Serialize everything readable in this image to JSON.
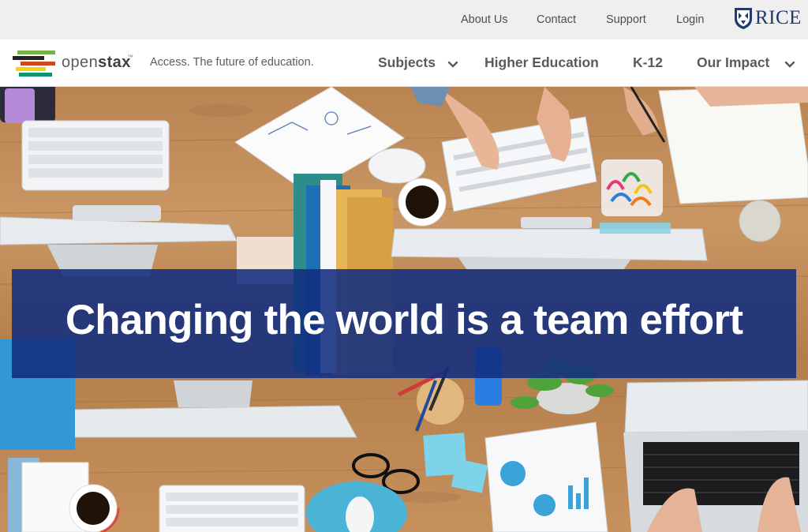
{
  "utility_nav": {
    "links": [
      "About Us",
      "Contact",
      "Support",
      "Login"
    ],
    "partner_logo_text": "RICE"
  },
  "brand": {
    "name_light": "open",
    "name_bold": "stax",
    "trademark": "™",
    "tagline": "Access. The future of education."
  },
  "main_nav": {
    "items": [
      {
        "label": "Subjects",
        "has_dropdown": true
      },
      {
        "label": "Higher Education",
        "has_dropdown": false
      },
      {
        "label": "K-12",
        "has_dropdown": false
      },
      {
        "label": "Our Impact",
        "has_dropdown": true
      }
    ]
  },
  "hero": {
    "headline": "Changing the world is a team effort",
    "image_description_icon": "team-desk-photo"
  },
  "colors": {
    "utility_bg": "#efefef",
    "banner_bg": "#112d80",
    "rice_blue": "#1f3a6c",
    "nav_text": "#5a5a5a",
    "logo_green": "#78b04a",
    "logo_red": "#d4451b",
    "logo_yellow": "#f4d019",
    "logo_blue": "#0c9372",
    "logo_dark": "#232323"
  }
}
